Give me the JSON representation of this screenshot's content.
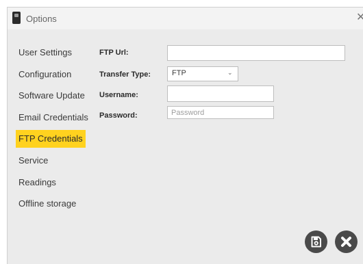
{
  "window": {
    "title": "Options"
  },
  "sidebar": {
    "items": [
      {
        "label": "User Settings"
      },
      {
        "label": "Configuration"
      },
      {
        "label": "Software Update"
      },
      {
        "label": "Email Credentials"
      },
      {
        "label": "FTP Credentials",
        "active": true
      },
      {
        "label": "Service"
      },
      {
        "label": "Readings"
      },
      {
        "label": "Offline storage"
      }
    ]
  },
  "form": {
    "ftp_url": {
      "label": "FTP Url:",
      "value": ""
    },
    "transfer_type": {
      "label": "Transfer Type:",
      "value": "FTP"
    },
    "username": {
      "label": "Username:",
      "value": ""
    },
    "password": {
      "label": "Password:",
      "value": "",
      "placeholder": "Password"
    }
  },
  "icons": {
    "app": "app-icon",
    "close": "close-icon",
    "save": "save-icon",
    "cancel": "cancel-icon",
    "dropdown": "chevron-down-icon"
  },
  "colors": {
    "active_highlight": "#ffd21f",
    "panel_background": "#ebebeb",
    "button": "#4a4a4a"
  }
}
